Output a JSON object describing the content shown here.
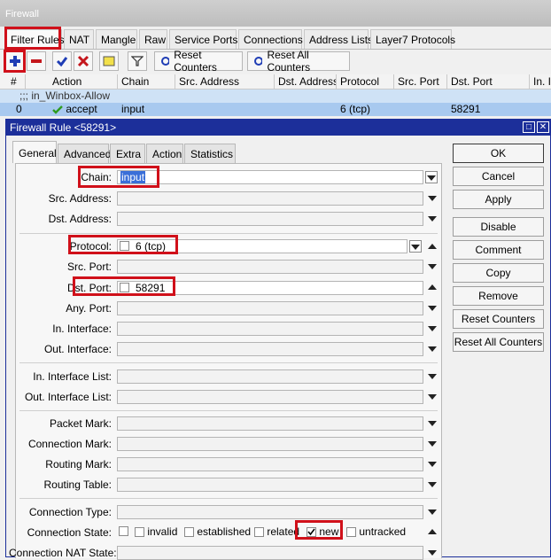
{
  "window": {
    "title": "Firewall"
  },
  "tabs": [
    {
      "label": "Filter Rules"
    },
    {
      "label": "NAT"
    },
    {
      "label": "Mangle"
    },
    {
      "label": "Raw"
    },
    {
      "label": "Service Ports"
    },
    {
      "label": "Connections"
    },
    {
      "label": "Address Lists"
    },
    {
      "label": "Layer7 Protocols"
    }
  ],
  "toolbar": {
    "reset_counters": "Reset Counters",
    "reset_all_counters": "Reset All Counters"
  },
  "table": {
    "columns": [
      "#",
      "Action",
      "Chain",
      "Src. Address",
      "Dst. Address",
      "Protocol",
      "Src. Port",
      "Dst. Port",
      "In. I"
    ],
    "comment_row": ";;; in_Winbox-Allow",
    "rows": [
      {
        "num": "0",
        "action": "accept",
        "chain": "input",
        "src": "",
        "dst": "",
        "protocol": "6 (tcp)",
        "src_port": "",
        "dst_port": "58291",
        "in": ""
      }
    ]
  },
  "dialog": {
    "title": "Firewall Rule <58291>",
    "tabs": [
      "General",
      "Advanced",
      "Extra",
      "Action",
      "Statistics"
    ],
    "fields": {
      "chain": {
        "label": "Chain:",
        "value": "input"
      },
      "src_address": {
        "label": "Src. Address:"
      },
      "dst_address": {
        "label": "Dst. Address:"
      },
      "protocol": {
        "label": "Protocol:",
        "value": "6 (tcp)"
      },
      "src_port": {
        "label": "Src. Port:"
      },
      "dst_port": {
        "label": "Dst. Port:",
        "value": "58291"
      },
      "any_port": {
        "label": "Any. Port:"
      },
      "in_interface": {
        "label": "In. Interface:"
      },
      "out_interface": {
        "label": "Out. Interface:"
      },
      "in_interface_list": {
        "label": "In. Interface List:"
      },
      "out_interface_list": {
        "label": "Out. Interface List:"
      },
      "packet_mark": {
        "label": "Packet Mark:"
      },
      "connection_mark": {
        "label": "Connection Mark:"
      },
      "routing_mark": {
        "label": "Routing Mark:"
      },
      "routing_table": {
        "label": "Routing Table:"
      },
      "connection_type": {
        "label": "Connection Type:"
      },
      "connection_state": {
        "label": "Connection State:"
      },
      "connection_nat_state": {
        "label": "Connection NAT State:"
      }
    },
    "states": [
      {
        "label": "invalid",
        "checked": false
      },
      {
        "label": "established",
        "checked": false
      },
      {
        "label": "related",
        "checked": false
      },
      {
        "label": "new",
        "checked": true
      },
      {
        "label": "untracked",
        "checked": false
      }
    ],
    "buttons": [
      "OK",
      "Cancel",
      "Apply",
      "Disable",
      "Comment",
      "Copy",
      "Remove",
      "Reset Counters",
      "Reset All Counters"
    ]
  },
  "colors": {
    "highlight": "#d0101a",
    "title_bar": "#1c2f9a",
    "selected_row": "#a8c9ef",
    "comment_row": "#cfe2f6",
    "accept_green": "#2e9b1f"
  }
}
